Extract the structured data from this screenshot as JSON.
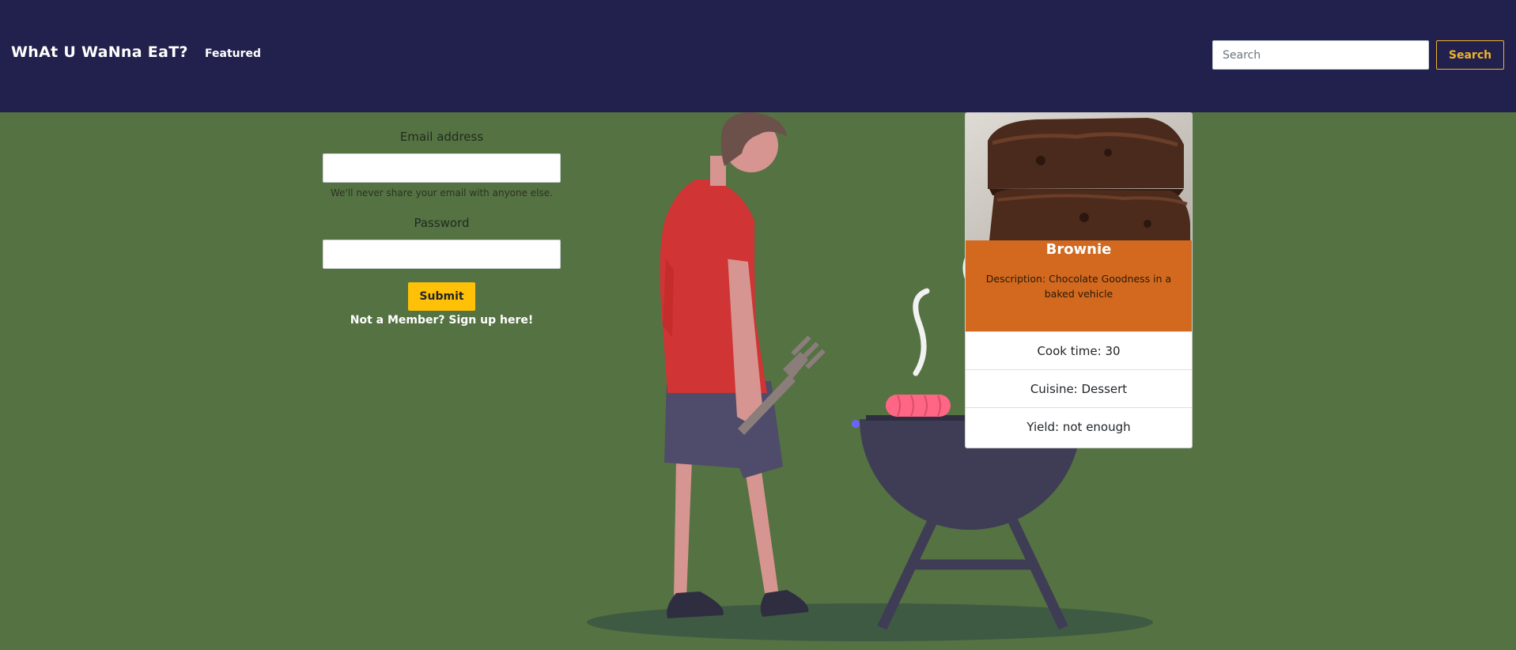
{
  "nav": {
    "brand": "WhAt U WaNna EaT?",
    "featured_label": "Featured",
    "search_placeholder": "Search",
    "search_button_label": "Search"
  },
  "login_form": {
    "email_label": "Email address",
    "email_value": "",
    "email_help": "We'll never share your email with anyone else.",
    "password_label": "Password",
    "password_value": "",
    "submit_label": "Submit",
    "signup_link": "Not a Member? Sign up here!"
  },
  "recipe_card": {
    "title": "Brownie",
    "description": "Description: Chocolate Goodness in a baked vehicle",
    "cook_time": "Cook time: 30",
    "cuisine": "Cuisine: Dessert",
    "yield": "Yield: not enough"
  },
  "colors": {
    "navbar": "#22214d",
    "page_background": "#557242",
    "accent_yellow": "#ffc107",
    "card_header": "#d2691e"
  },
  "icons": {
    "illustration": "person-grilling-illustration",
    "card_image": "brownie-photo"
  }
}
